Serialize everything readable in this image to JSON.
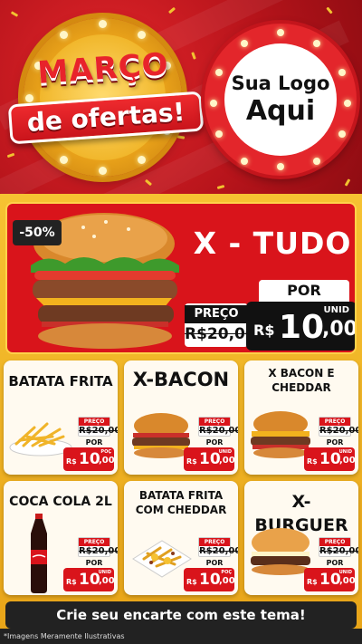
{
  "header": {
    "title_line1": "MARÇO",
    "title_line2": "de ofertas!",
    "logo_line1": "Sua Logo",
    "logo_line2": "Aqui"
  },
  "featured": {
    "discount_badge": "-50%",
    "name": "X - TUDO",
    "preco_label": "PREÇO",
    "old_price": "R$20,00",
    "por_label": "POR",
    "unit_label": "UNID",
    "currency": "R$",
    "price_int": "10",
    "price_dec": ",00"
  },
  "products": [
    {
      "name": "BATATA FRITA",
      "preco_label": "PREÇO",
      "old_price": "R$20,00",
      "por_label": "POR",
      "unit_label": "POÇ",
      "currency": "R$",
      "price_int": "10",
      "price_dec": ",00"
    },
    {
      "name": "X-BACON",
      "preco_label": "PREÇO",
      "old_price": "R$20,00",
      "por_label": "POR",
      "unit_label": "UNID",
      "currency": "R$",
      "price_int": "10",
      "price_dec": ",00"
    },
    {
      "name": "X BACON E CHEDDAR",
      "preco_label": "PREÇO",
      "old_price": "R$20,00",
      "por_label": "POR",
      "unit_label": "UNID",
      "currency": "R$",
      "price_int": "10",
      "price_dec": ",00"
    },
    {
      "name": "COCA COLA 2L",
      "preco_label": "PREÇO",
      "old_price": "R$20,00",
      "por_label": "POR",
      "unit_label": "UNID",
      "currency": "R$",
      "price_int": "10",
      "price_dec": ",00"
    },
    {
      "name": "BATATA FRITA COM CHEDDAR",
      "preco_label": "PREÇO",
      "old_price": "R$20,00",
      "por_label": "POR",
      "unit_label": "POÇ",
      "currency": "R$",
      "price_int": "10",
      "price_dec": ",00"
    },
    {
      "name": "X-BURGUER",
      "preco_label": "PREÇO",
      "old_price": "R$20,00",
      "por_label": "POR",
      "unit_label": "UNID",
      "currency": "R$",
      "price_int": "10",
      "price_dec": ",00"
    }
  ],
  "footer": {
    "cta": "Crie seu encarte com este tema!",
    "disclaimer": "*Imagens Meramente Ilustrativas"
  },
  "colors": {
    "primary_red": "#d9141b",
    "gold": "#f6c232",
    "dark": "#222222"
  },
  "icons": [
    "burger-image",
    "fries-image",
    "cola-bottle-image",
    "cheese-fries-image"
  ]
}
